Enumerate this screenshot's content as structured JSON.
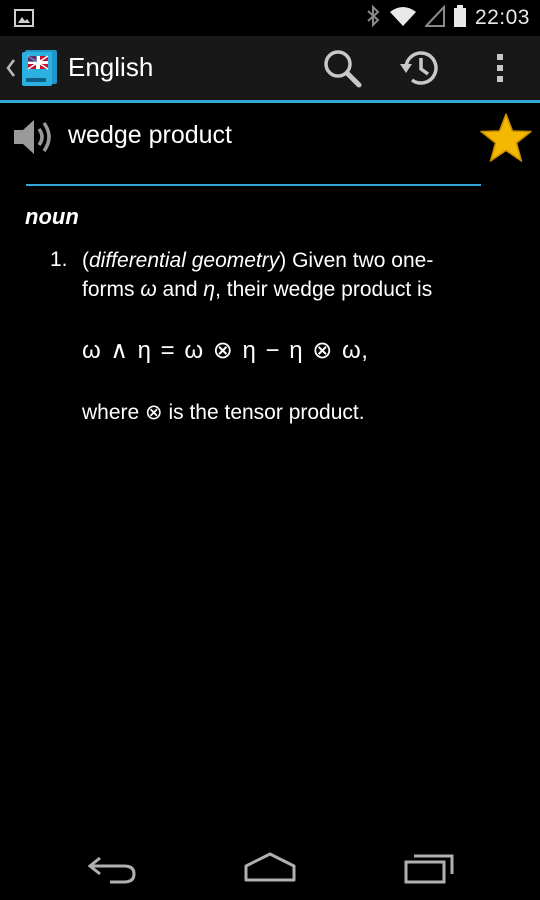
{
  "status_bar": {
    "time": "22:03",
    "icons": [
      "image-notification-icon",
      "bluetooth-icon",
      "wifi-icon",
      "cell-signal-icon",
      "battery-icon"
    ]
  },
  "action_bar": {
    "title": "English",
    "icons": [
      "dictionary-logo-icon",
      "search-icon",
      "history-icon",
      "overflow-menu-icon"
    ],
    "accent_color": "#33a8d4"
  },
  "entry": {
    "headword": "wedge product",
    "favorite_color": "#f5b800",
    "part_of_speech": "noun",
    "definitions": [
      {
        "number": "1.",
        "label_open": "(",
        "label": "differential geometry",
        "label_close": ")",
        "text_1": " Given two one-forms ",
        "omega": "ω",
        "text_2": " and ",
        "eta": "η",
        "text_3": ", their wedge product is",
        "formula": "ω ∧ η = ω ⊗ η − η ⊗ ω,",
        "note": "where ⊗ is the tensor product."
      }
    ]
  },
  "nav_bar": {
    "icons": [
      "back-icon",
      "home-icon",
      "recent-apps-icon"
    ]
  }
}
